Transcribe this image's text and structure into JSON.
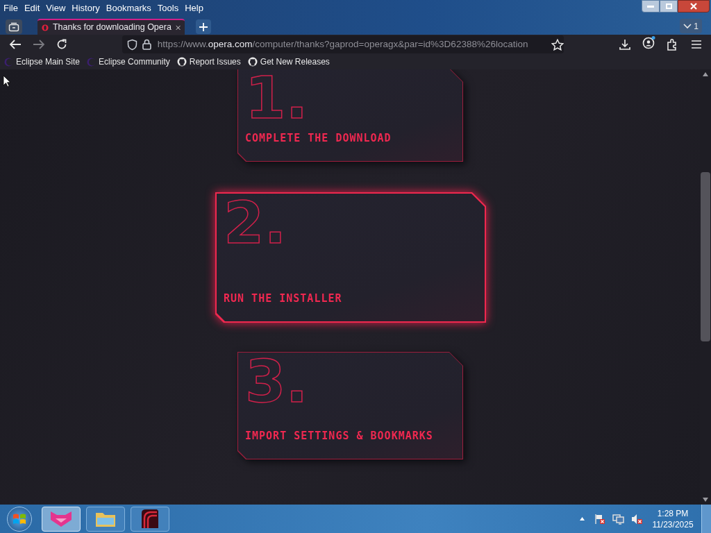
{
  "menu": [
    "File",
    "Edit",
    "View",
    "History",
    "Bookmarks",
    "Tools",
    "Help"
  ],
  "tabs": [
    {
      "title": "Thanks for downloading Opera",
      "selected": true
    }
  ],
  "tab_count": "1",
  "address": {
    "scheme": "https://www.",
    "domain": "opera.com",
    "path": "/computer/thanks?gaprod=operagx&par=id%3D62388%26location"
  },
  "bookmarks": [
    {
      "label": "Eclipse Main Site",
      "kind": "eclipse"
    },
    {
      "label": "Eclipse Community",
      "kind": "eclipse"
    },
    {
      "label": "Report Issues",
      "kind": "github"
    },
    {
      "label": "Get New Releases",
      "kind": "github"
    }
  ],
  "steps": [
    {
      "number": "1.",
      "label": "COMPLETE THE DOWNLOAD",
      "selected": false
    },
    {
      "number": "2.",
      "label": "RUN THE INSTALLER",
      "selected": true
    },
    {
      "number": "3.",
      "label": "IMPORT SETTINGS & BOOKMARKS",
      "selected": false
    }
  ],
  "taskbar": {
    "apps": [
      {
        "kind": "gx",
        "selected": true
      },
      {
        "kind": "folder",
        "selected": false
      },
      {
        "kind": "red",
        "selected": false
      }
    ],
    "time": "1:28 PM",
    "date": "11/23/2025"
  }
}
